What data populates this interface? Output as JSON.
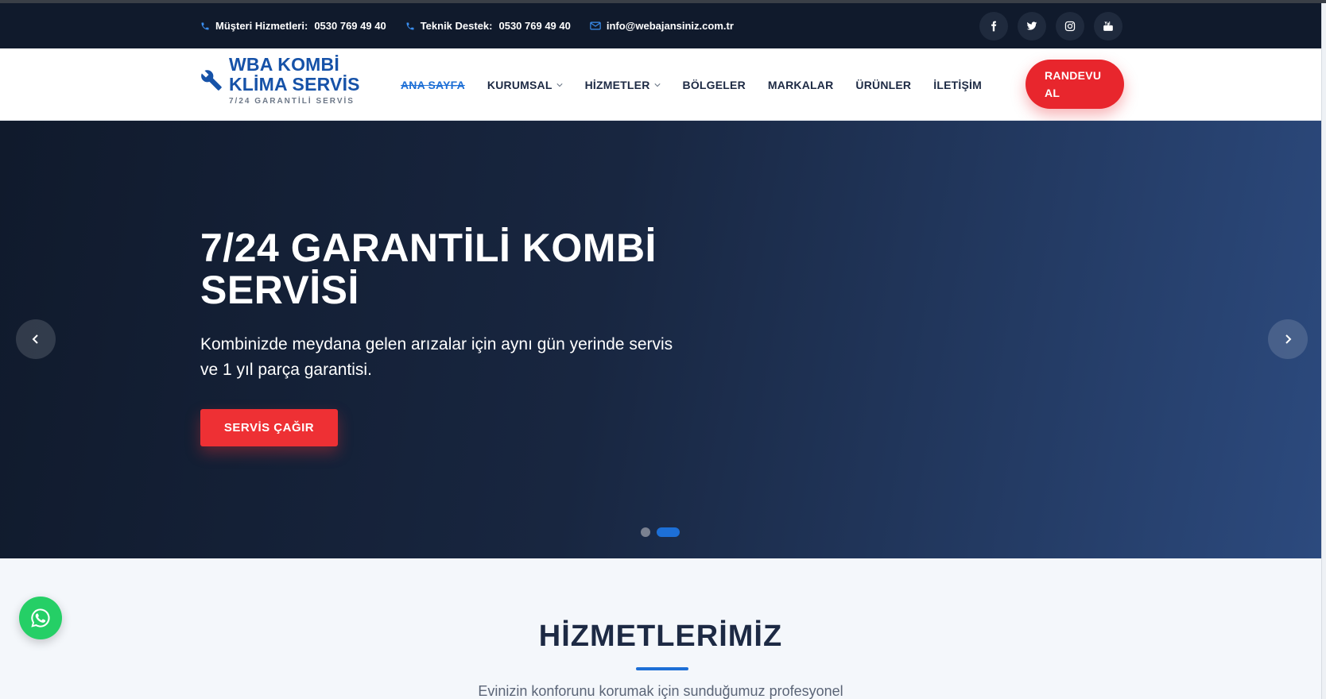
{
  "topbar": {
    "customer_label": "Müşteri Hizmetleri:",
    "customer_phone": "0530 769 49 40",
    "support_label": "Teknik Destek:",
    "support_phone": "0530 769 49 40",
    "email": "info@webajansiniz.com.tr",
    "socials": [
      "facebook-icon",
      "twitter-icon",
      "instagram-icon",
      "youtube-icon"
    ]
  },
  "logo": {
    "line1": "WBA KOMBİ",
    "line2": "KLİMA SERVİS",
    "tagline": "7/24 GARANTİLİ SERVİS"
  },
  "nav": {
    "items": [
      {
        "label": "ANA SAYFA",
        "active": true,
        "dropdown": false
      },
      {
        "label": "KURUMSAL",
        "active": false,
        "dropdown": true
      },
      {
        "label": "HİZMETLER",
        "active": false,
        "dropdown": true
      },
      {
        "label": "BÖLGELER",
        "active": false,
        "dropdown": false
      },
      {
        "label": "MARKALAR",
        "active": false,
        "dropdown": false
      },
      {
        "label": "ÜRÜNLER",
        "active": false,
        "dropdown": false
      },
      {
        "label": "İLETİŞİM",
        "active": false,
        "dropdown": false
      }
    ],
    "cta_line1": "RANDEVU",
    "cta_line2": "AL"
  },
  "hero": {
    "title_line1": "7/24 GARANTİLİ KOMBİ",
    "title_line2": "SERVİSİ",
    "subtitle_line1": "Kombinizde meydana gelen arızalar için aynı gün yerinde servis",
    "subtitle_line2": "ve 1 yıl parça garantisi.",
    "button": "SERVİS ÇAĞIR",
    "slide_count": 2,
    "active_slide": 2
  },
  "services": {
    "title": "HİZMETLERİMİZ",
    "subtitle": "Evinizin konforunu korumak için sunduğumuz profesyonel"
  },
  "colors": {
    "topbar": "#101a2c",
    "brand_blue": "#1652a8",
    "accent_blue": "#1d6fd6",
    "cta_red": "#e8262d",
    "whatsapp": "#25cf66"
  }
}
